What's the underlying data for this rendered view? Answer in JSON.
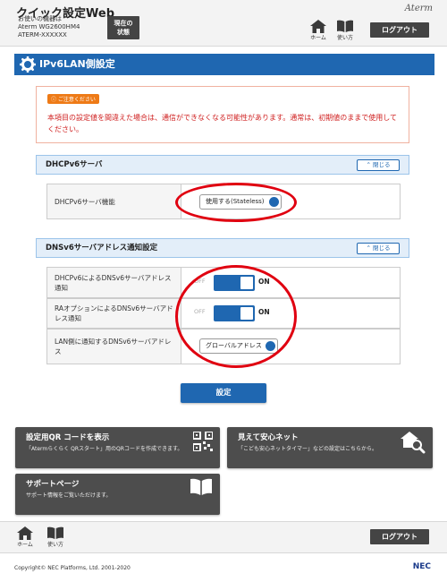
{
  "header": {
    "app_title": "クイック設定Web",
    "device_label": "お使いの機器は",
    "device_model": "Aterm WG2600HM4",
    "device_id": "ATERM-XXXXXX",
    "status_button": [
      "現在の",
      "状態"
    ],
    "home_label": "ホーム",
    "howto_label": "使い方",
    "logout_label": "ログアウト",
    "brand": "Aterm"
  },
  "page": {
    "title": "IPv6LAN側設定"
  },
  "warning": {
    "badge": "ご注意ください",
    "text": "本項目の設定値を間違えた場合は、通信ができなくなる可能性があります。通常は、初期値のままで使用してください。"
  },
  "dhcpv6_section": {
    "heading": "DHCPv6サーバ",
    "close_label": "閉じる",
    "rows": [
      {
        "label": "DHCPv6サーバ機能",
        "value": "使用する(Stateless)"
      }
    ]
  },
  "dns_section": {
    "heading": "DNSv6サーバアドレス通知設定",
    "close_label": "閉じる",
    "rows": [
      {
        "label": "DHCPv6によるDNSv6サーバアドレス通知",
        "off": "OFF",
        "on": "ON",
        "state": "ON"
      },
      {
        "label": "RAオプションによるDNSv6サーバアドレス通知",
        "off": "OFF",
        "on": "ON",
        "state": "ON"
      },
      {
        "label": "LAN側に通知するDNSv6サーバアドレス",
        "value": "グローバルアドレス"
      }
    ]
  },
  "actions": {
    "settings_button": "設定"
  },
  "cards": [
    {
      "title": "設定用QR コードを表示",
      "desc": "「Atermらくらく QRスタート」用のQRコードを作成できます。",
      "icon": "qr-code-icon"
    },
    {
      "title": "見えて安心ネット",
      "desc": "「こども安心ネットタイマー」などの設定はこちらから。",
      "icon": "house-search-icon"
    },
    {
      "title": "サポートページ",
      "desc": "サポート情報をご覧いただけます。",
      "icon": "book-icon"
    }
  ],
  "footer": {
    "home_label": "ホーム",
    "howto_label": "使い方",
    "logout_label": "ログアウト",
    "copyright": "Copyright© NEC Platforms, Ltd. 2001-2020",
    "nec": "NEC"
  },
  "colors": {
    "primary": "#1f67b1",
    "warning_text": "#cf1e1e",
    "annotation_circle": "#e00010",
    "dark_card": "#4d4d4d"
  }
}
